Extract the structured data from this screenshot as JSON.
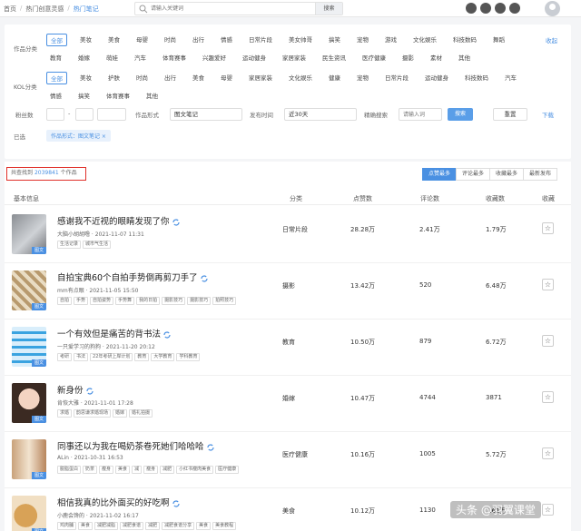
{
  "breadcrumb": [
    "首页",
    "热门创意灵感",
    "热门笔记"
  ],
  "search": {
    "placeholder": "请输入关键词",
    "button": "搜索"
  },
  "filters": {
    "category_label": "作品分类",
    "categories": [
      "全部",
      "美妆",
      "美食",
      "母婴",
      "时尚",
      "出行",
      "情感",
      "日常片段",
      "美女帅哥",
      "搞笑",
      "宠物",
      "游戏",
      "文化娱乐",
      "科技数码",
      "舞蹈",
      "教育",
      "婚嫁",
      "萌娃",
      "汽车",
      "体育赛事",
      "兴趣爱好",
      "运动健身",
      "家居家装",
      "民生资讯",
      "医疗健康",
      "摄影",
      "素材",
      "其他"
    ],
    "collapse_label": "收起",
    "kol_label": "KOL分类",
    "kol_categories": [
      "全部",
      "美妆",
      "护肤",
      "时尚",
      "出行",
      "美食",
      "母婴",
      "家居家装",
      "文化娱乐",
      "健康",
      "宠物",
      "日常片段",
      "运动健身",
      "科技数码",
      "汽车",
      "情感",
      "搞笑",
      "体育赛事",
      "其他"
    ],
    "fans_label": "粉丝数",
    "form_label": "作品形式",
    "form_value": "图文笔记",
    "time_label": "发布时间",
    "time_value": "近30天",
    "precise_label": "精确搜索",
    "precise_placeholder": "请输入词",
    "search_button": "搜索",
    "reset_button": "重置",
    "download_link": "下载",
    "chosen_label": "已选",
    "chosen_chip": "作品形式：图文笔记 ×"
  },
  "results": {
    "count_prefix": "共查找到",
    "count": "2039841",
    "count_suffix": "个作品",
    "sort_tabs": [
      "点赞最多",
      "评论最多",
      "收藏最多",
      "最新发布"
    ],
    "headers": [
      "基本信息",
      "分类",
      "点赞数",
      "评论数",
      "收藏数",
      "收藏"
    ],
    "badge": "图文",
    "rows": [
      {
        "title": "感谢我不近视的眼睛发现了你",
        "meta": "大脑小胡胡噜 · 2021-11-07 11:31",
        "tags": [
          "生活记录",
          "城市气生活"
        ],
        "category": "日常片段",
        "likes": "28.28万",
        "comments": "2.41万",
        "favorites": "1.79万"
      },
      {
        "title": "自拍宝典60个自拍手势倒再剪刀手了",
        "meta": "mm有点眼 · 2021-11-05 15:50",
        "tags": [
          "自拍",
          "手势",
          "自拍姿势",
          "手势舞",
          "我的日拍",
          "摄影技巧",
          "摄影技巧",
          "拍照技巧"
        ],
        "category": "摄影",
        "likes": "13.42万",
        "comments": "520",
        "favorites": "6.48万"
      },
      {
        "title": "一个有效但是痛苦的背书法",
        "meta": "一只爱学习的狗狗 · 2021-11-20 20:12",
        "tags": [
          "考研",
          "书法",
          "22年考研上岸计划",
          "教育",
          "大学教育",
          "学科教育"
        ],
        "category": "教育",
        "likes": "10.50万",
        "comments": "879",
        "favorites": "6.72万"
      },
      {
        "title": "新身份",
        "meta": "肯恢大雅 · 2021-11-01 17:28",
        "tags": [
          "求婚",
          "韵思谦求婚现场",
          "婚嫁",
          "婚礼拍摄"
        ],
        "category": "婚嫁",
        "likes": "10.47万",
        "comments": "4744",
        "favorites": "3871"
      },
      {
        "title": "同事还以为我在喝奶茶卷死她们哈哈哈",
        "meta": "ALin · 2021-10-31 16:53",
        "tags": [
          "脱脂蛋白",
          "奶茶",
          "瘦身",
          "美食",
          "减",
          "瘦身",
          "减肥",
          "小红书瘦肉美食",
          "医疗健康"
        ],
        "category": "医疗健康",
        "likes": "10.16万",
        "comments": "1005",
        "favorites": "5.72万"
      },
      {
        "title": "相信我真的比外面买的好吃啊",
        "meta": "小鹿会馋的 · 2021-11-02 16:17",
        "tags": [
          "鸡肉脯",
          "美食",
          "减肥减脂",
          "减肥食谱",
          "减肥",
          "减肥食谱分享",
          "美食",
          "美食教程"
        ],
        "category": "美食",
        "likes": "10.12万",
        "comments": "1130",
        "favorites": "7.61万"
      }
    ]
  },
  "watermark": "头条 @羽翼课堂"
}
